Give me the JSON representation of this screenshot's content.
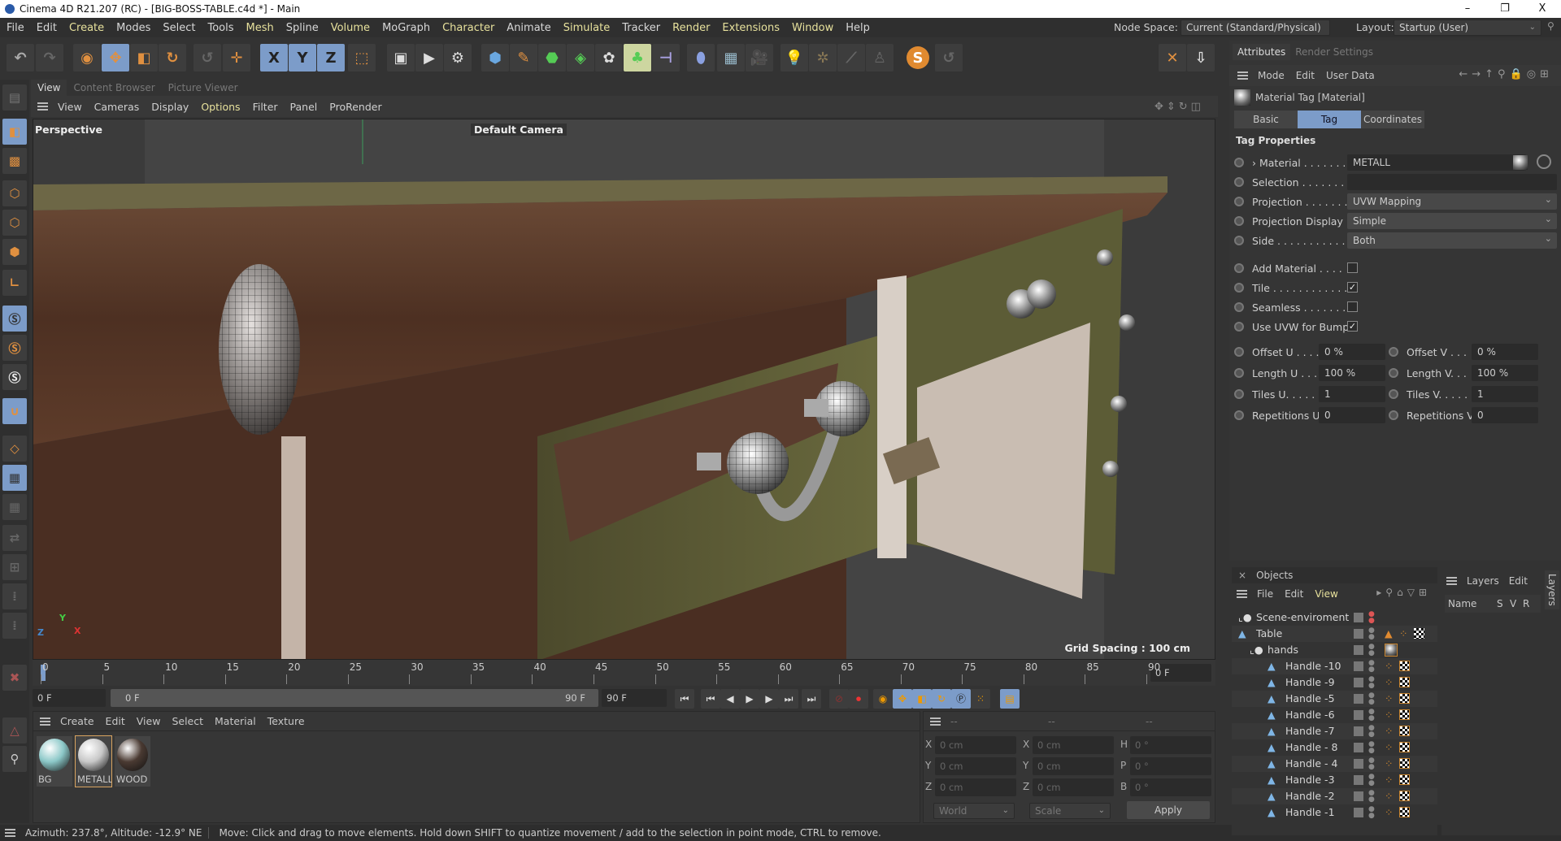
{
  "window": {
    "title": "Cinema 4D R21.207 (RC) - [BIG-BOSS-TABLE.c4d *] - Main",
    "minimize": "–",
    "restore": "❐",
    "close": "X"
  },
  "menu": [
    "File",
    "Edit",
    "Create",
    "Modes",
    "Select",
    "Tools",
    "Mesh",
    "Spline",
    "Volume",
    "MoGraph",
    "Character",
    "Animate",
    "Simulate",
    "Tracker",
    "Render",
    "Extensions",
    "Window",
    "Help"
  ],
  "node_space": {
    "label": "Node Space:",
    "value": "Current (Standard/Physical)"
  },
  "layout": {
    "label": "Layout:",
    "value": "Startup (User)"
  },
  "toolbar": {
    "x": "X",
    "y": "Y",
    "z": "Z",
    "s": "S"
  },
  "view_tabs": [
    "View",
    "Content Browser",
    "Picture Viewer"
  ],
  "view_menu": [
    "View",
    "Cameras",
    "Display",
    "Options",
    "Filter",
    "Panel",
    "ProRender"
  ],
  "viewport": {
    "mode": "Perspective",
    "camera": "Default Camera",
    "grid_spacing": "Grid Spacing : 100 cm",
    "axis": {
      "x": "X",
      "y": "Y",
      "z": "Z"
    }
  },
  "timeline": {
    "ticks": [
      "0",
      "5",
      "10",
      "15",
      "20",
      "25",
      "30",
      "35",
      "40",
      "45",
      "50",
      "55",
      "60",
      "65",
      "70",
      "75",
      "80",
      "85",
      "90"
    ],
    "current_frame": "0 F",
    "start": "0 F",
    "range_start": "0 F",
    "range_end": "90 F",
    "end": "90 F"
  },
  "material_manager": {
    "menu": [
      "Create",
      "Edit",
      "View",
      "Select",
      "Material",
      "Texture"
    ],
    "materials": [
      {
        "name": "BG",
        "color": "#8cc8c8"
      },
      {
        "name": "METALL",
        "color": "#c8c8c8"
      },
      {
        "name": "WOOD",
        "color": "#4a3a32"
      }
    ]
  },
  "coords": {
    "header": [
      "--",
      "--",
      "--"
    ],
    "rows": [
      {
        "a": "X",
        "av": "0 cm",
        "b": "X",
        "bv": "0 cm",
        "c": "H",
        "cv": "0 °"
      },
      {
        "a": "Y",
        "av": "0 cm",
        "b": "Y",
        "bv": "0 cm",
        "c": "P",
        "cv": "0 °"
      },
      {
        "a": "Z",
        "av": "0 cm",
        "b": "Z",
        "bv": "0 cm",
        "c": "B",
        "cv": "0 °"
      }
    ],
    "world": "World",
    "scale": "Scale",
    "apply": "Apply"
  },
  "status": {
    "azimuth": "Azimuth: 237.8°, Altitude: -12.9°  NE",
    "message": "Move: Click and drag to move elements. Hold down SHIFT to quantize movement / add to the selection in point mode, CTRL to remove."
  },
  "attributes": {
    "tabs": [
      "Attributes",
      "Render Settings"
    ],
    "menu": [
      "Mode",
      "Edit",
      "User Data"
    ],
    "object_title": "Material Tag [Material]",
    "subtabs": [
      "Basic",
      "Tag",
      "Coordinates"
    ],
    "section": "Tag Properties",
    "material": {
      "label": "› Material . . . . . . .",
      "value": "METALL"
    },
    "selection": {
      "label": "Selection . . . . . . .",
      "value": ""
    },
    "projection": {
      "label": "Projection . . . . . . .",
      "value": "UVW Mapping"
    },
    "projection_display": {
      "label": "Projection Display",
      "value": "Simple"
    },
    "side": {
      "label": "Side . . . . . . . . . . .",
      "value": "Both"
    },
    "checks": [
      {
        "label": "Add Material . . . .",
        "checked": false
      },
      {
        "label": "Tile . . . . . . . . . . . .",
        "checked": true
      },
      {
        "label": "Seamless . . . . . . .",
        "checked": false
      },
      {
        "label": "Use UVW for Bump",
        "checked": true
      }
    ],
    "pairs": [
      {
        "l1": "Offset U . . . .",
        "v1": "0 %",
        "l2": "Offset V . . .",
        "v2": "0 %"
      },
      {
        "l1": "Length U . . . .",
        "v1": "100 %",
        "l2": "Length V. . .",
        "v2": "100 %"
      },
      {
        "l1": "Tiles U. . . . . .",
        "v1": "1",
        "l2": "Tiles V. . . . .",
        "v2": "1"
      },
      {
        "l1": "Repetitions U",
        "v1": "0",
        "l2": "Repetitions V",
        "v2": "0"
      }
    ]
  },
  "objects": {
    "title": "Objects",
    "menu": [
      "File",
      "Edit",
      "View"
    ],
    "items": [
      {
        "name": "Scene-enviroment",
        "level": 0
      },
      {
        "name": "Table",
        "level": 0
      },
      {
        "name": "hands",
        "level": 1
      },
      {
        "name": "Handle -10",
        "level": 2
      },
      {
        "name": "Handle -9",
        "level": 2
      },
      {
        "name": "Handle -5",
        "level": 2
      },
      {
        "name": "Handle -6",
        "level": 2
      },
      {
        "name": "Handle -7",
        "level": 2
      },
      {
        "name": "Handle - 8",
        "level": 2
      },
      {
        "name": "Handle - 4",
        "level": 2
      },
      {
        "name": "Handle -3",
        "level": 2
      },
      {
        "name": "Handle -2",
        "level": 2
      },
      {
        "name": "Handle -1",
        "level": 2
      }
    ]
  },
  "layers": {
    "title": "Layers",
    "edit": "Edit",
    "side_tab": "Layers",
    "cols": [
      "Name",
      "S",
      "V",
      "R"
    ]
  }
}
